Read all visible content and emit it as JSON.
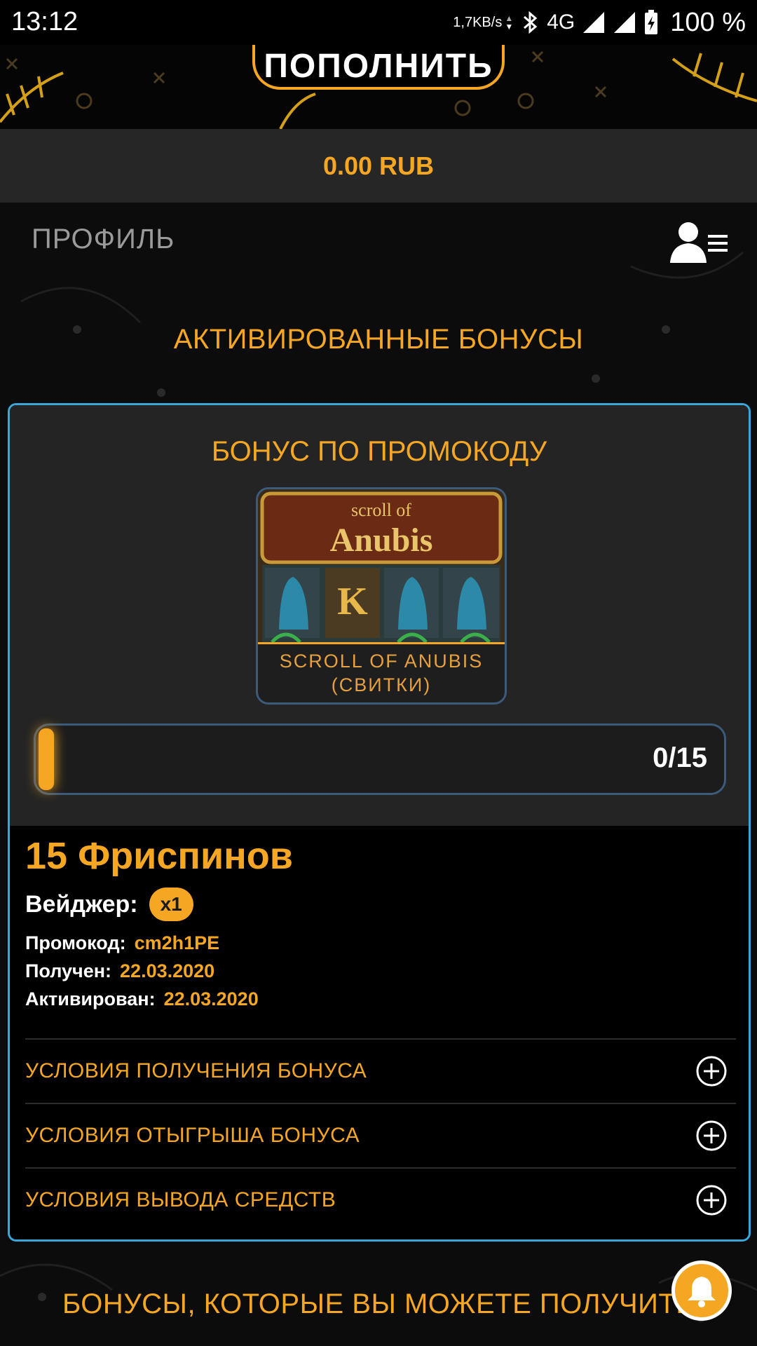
{
  "status_bar": {
    "time": "13:12",
    "net_speed": "1,7KB/s",
    "network": "4G",
    "battery": "100 %"
  },
  "header": {
    "deposit_label": "ПОПОЛНИТЬ",
    "balance": "0.00 RUB"
  },
  "profile": {
    "title": "ПРОФИЛЬ",
    "menu_icon": "user-menu-icon"
  },
  "activated_title": "АКТИВИРОВАННЫЕ БОНУСЫ",
  "bonus_card": {
    "title": "БОНУС ПО ПРОМОКОДУ",
    "game": {
      "logo_line1": "scroll of",
      "logo_line2": "Anubis",
      "name_line1": "SCROLL OF ANUBIS",
      "name_line2": "(СВИТКИ)"
    },
    "progress": {
      "text": "0/15",
      "fraction": 0.0
    },
    "amount": "15 Фриспинов",
    "wager_label": "Вейджер:",
    "wager_value": "x1",
    "promo_label": "Промокод:",
    "promo_value": "cm2h1PE",
    "received_label": "Получен:",
    "received_value": "22.03.2020",
    "activated_label": "Активирован:",
    "activated_value": "22.03.2020",
    "conditions": [
      {
        "label": "УСЛОВИЯ ПОЛУЧЕНИЯ БОНУСА"
      },
      {
        "label": "УСЛОВИЯ ОТЫГРЫША БОНУСА"
      },
      {
        "label": "УСЛОВИЯ ВЫВОДА СРЕДСТВ"
      }
    ]
  },
  "available_title": "БОНУСЫ, КОТОРЫЕ ВЫ МОЖЕТЕ ПОЛУЧИТЬ",
  "colors": {
    "accent": "#f5a623",
    "card_border": "#3aa6d9",
    "background": "#0c0c0c"
  }
}
